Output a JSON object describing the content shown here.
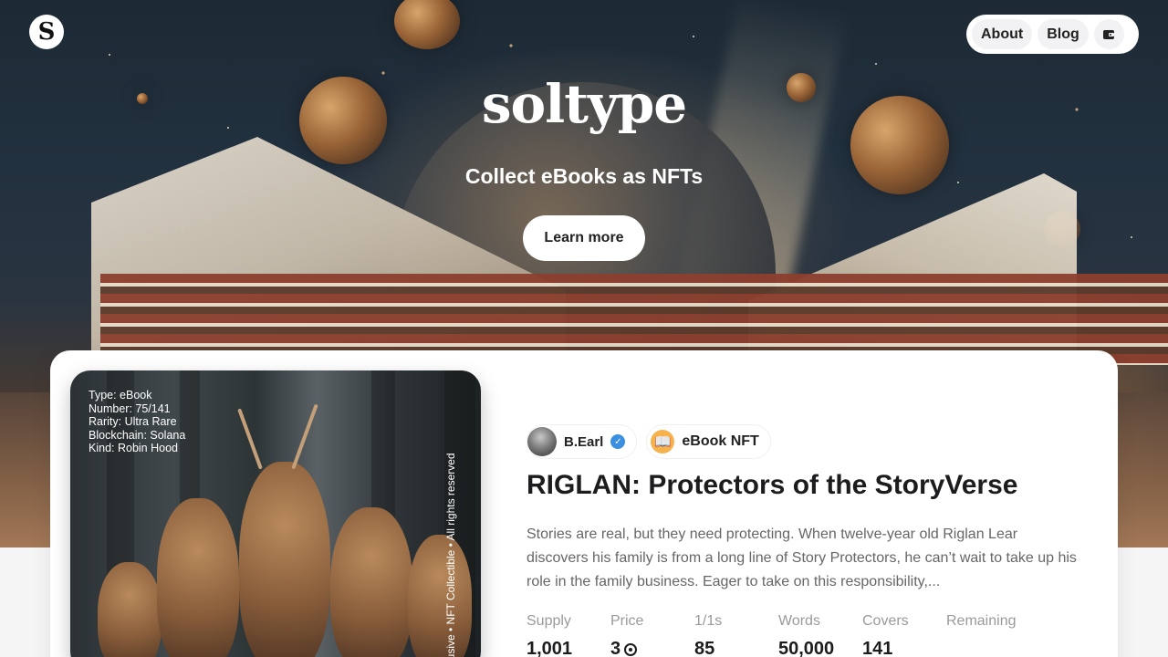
{
  "header": {
    "logo_letter": "S",
    "nav": [
      {
        "label": "About"
      },
      {
        "label": "Blog"
      }
    ],
    "wallet_icon": "wallet-icon"
  },
  "hero": {
    "brand": "soltype",
    "tagline": "Collect eBooks as NFTs",
    "cta": "Learn more"
  },
  "book": {
    "cover_meta": [
      "Type: eBook",
      "Number: 75/141",
      "Rarity: Ultra Rare",
      "Blockchain: Solana",
      "Kind: Robin Hood"
    ],
    "cover_side_text": "lusive • NFT Collectible • All rights reserved",
    "author": "B.Earl",
    "verified_icon": "verified-check-icon",
    "category_emoji": "📖",
    "category": "eBook NFT",
    "title": "RIGLAN: Protectors of the StoryVerse",
    "description": "Stories are real, but they need protecting. When twelve-year old Riglan Lear discovers his family is from a long line of Story Protectors, he can’t wait to take up his role in the family business. Eager to take on this responsibility,...",
    "stats": [
      {
        "label": "Supply",
        "value": "1,001"
      },
      {
        "label": "Price",
        "value": "3"
      },
      {
        "label": "1/1s",
        "value": "85"
      },
      {
        "label": "Words",
        "value": "50,000"
      },
      {
        "label": "Covers",
        "value": "141"
      },
      {
        "label": "Remaining",
        "value": ""
      }
    ]
  },
  "colors": {
    "page_background": "#f5f5f6",
    "card_background": "#ffffff",
    "verified_blue": "#3b8fe0",
    "text_primary": "#1c1c1e",
    "text_muted": "#9a9a9a"
  }
}
